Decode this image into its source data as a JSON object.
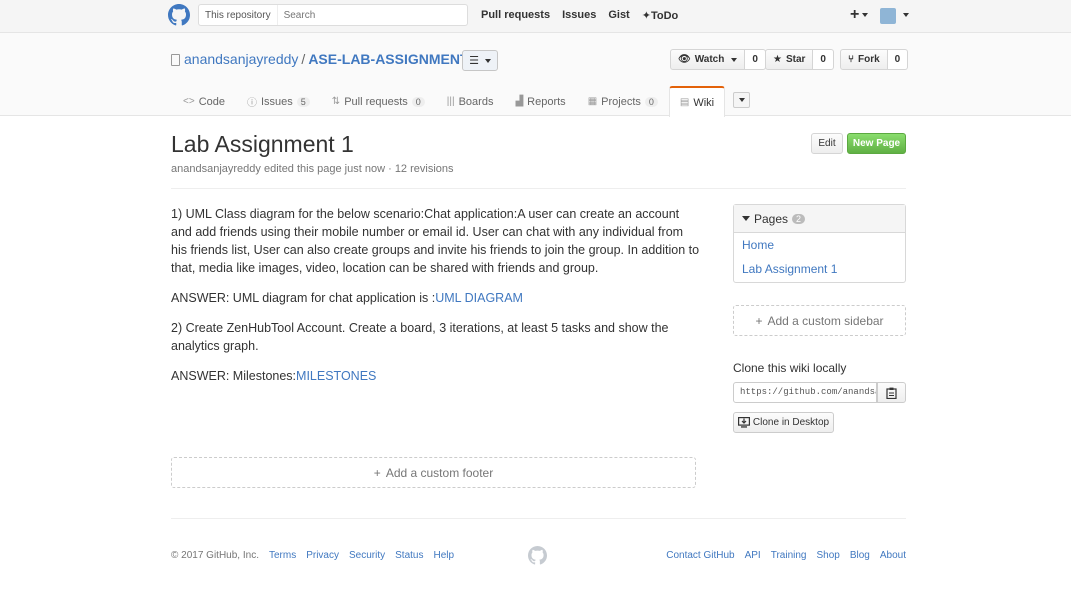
{
  "header": {
    "search_scope": "This repository",
    "search_placeholder": "Search",
    "nav": [
      "Pull requests",
      "Issues",
      "Gist",
      "ToDo"
    ],
    "plus_icon": "+"
  },
  "repo": {
    "owner": "anandsanjayreddy",
    "separator": "/",
    "name": "ASE-LAB-ASSIGNMENTS",
    "watch_label": "Watch",
    "watch_count": "0",
    "star_label": "Star",
    "star_count": "0",
    "fork_label": "Fork",
    "fork_count": "0"
  },
  "tabs": [
    {
      "label": "Code",
      "icon": "<>",
      "counter": ""
    },
    {
      "label": "Issues",
      "icon": "ⓘ",
      "counter": "5"
    },
    {
      "label": "Pull requests",
      "icon": "⇅",
      "counter": "0"
    },
    {
      "label": "Boards",
      "icon": "|||",
      "counter": ""
    },
    {
      "label": "Reports",
      "icon": "▟",
      "counter": ""
    },
    {
      "label": "Projects",
      "icon": "▦",
      "counter": "0"
    },
    {
      "label": "Wiki",
      "icon": "▤",
      "counter": ""
    }
  ],
  "wiki": {
    "title": "Lab Assignment 1",
    "meta": "anandsanjayreddy edited this page just now · 12 revisions",
    "edit_label": "Edit",
    "new_page_label": "New Page",
    "q1": "1) UML Class diagram for the below scenario:Chat application:A user can create an account and add friends using their mobile number or email id. User can chat with any individual from his friends list, User can also create groups and invite his friends to join the group. In addition to that, media like images, video, location can be shared with friends and group.",
    "a1_prefix": "ANSWER: UML diagram for chat application is :",
    "a1_link": "UML DIAGRAM",
    "q2": "2) Create ZenHubTool Account. Create a board, 3 iterations, at least 5 tasks and show the analytics graph.",
    "a2_prefix": "ANSWER: Milestones:",
    "a2_link": "MILESTONES",
    "add_footer": "Add a custom footer"
  },
  "sidebar": {
    "pages_label": "Pages",
    "pages_count": "2",
    "pages": [
      "Home",
      "Lab Assignment 1"
    ],
    "add_sidebar": "Add a custom sidebar",
    "clone_label": "Clone this wiki locally",
    "clone_url": "https://github.com/anandsanjayreddy/ASE-LAB-ASSIGNMENTS.wiki.git",
    "clone_desktop": "Clone in Desktop"
  },
  "footer": {
    "copyright": "© 2017 GitHub, Inc.",
    "left_links": [
      "Terms",
      "Privacy",
      "Security",
      "Status",
      "Help"
    ],
    "right_links": [
      "Contact GitHub",
      "API",
      "Training",
      "Shop",
      "Blog",
      "About"
    ]
  }
}
